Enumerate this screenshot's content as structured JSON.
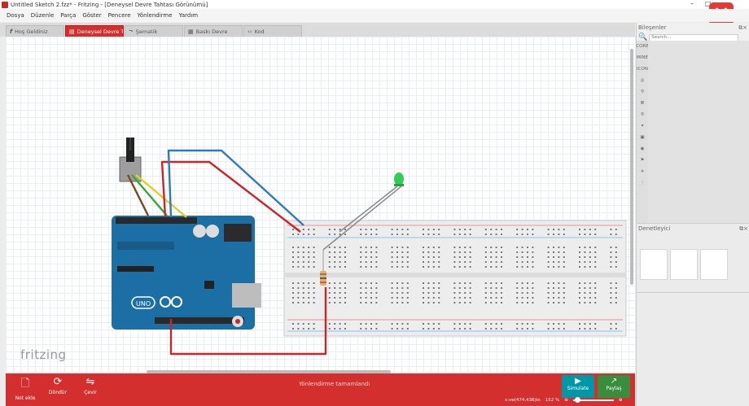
{
  "window": {
    "title": "Untitled Sketch 2.fzz* - Fritzing - [Deneysel Devre Tahtası Görünümü]",
    "minimize": "–",
    "restore": "□",
    "close_overlay": "✕"
  },
  "menu": [
    "Dosya",
    "Düzenle",
    "Parça",
    "Göster",
    "Pencere",
    "Yönlendirme",
    "Yardım"
  ],
  "tabs": [
    {
      "label": "Hoş Geldiniz",
      "icon": "f-logo-icon"
    },
    {
      "label": "Deneysel Devre Tahtası",
      "icon": "breadboard-icon",
      "active": true
    },
    {
      "label": "Şematik",
      "icon": "schematic-icon"
    },
    {
      "label": "Baskı Devre",
      "icon": "pcb-icon"
    },
    {
      "label": "Kod",
      "icon": "code-icon"
    }
  ],
  "canvas": {
    "watermark": "fritzing",
    "arduino_label": "UNO"
  },
  "toolbar": {
    "note": "Not ekle",
    "rotate": "Döndür",
    "flip": "Çevir",
    "status": "Yönlendirme tamamlandı",
    "simulate": "Simulate",
    "share": "Paylaş"
  },
  "footer": {
    "coords": "x:ve(474,436)in",
    "zoom": "152 %"
  },
  "panels": {
    "parts_title": "Bileşenler",
    "search_placeholder": "Search...",
    "inspector_title": "Denetleyici",
    "bins": [
      "CORE",
      "MINE",
      "ICON"
    ]
  },
  "colors": {
    "accent": "#d32f2f",
    "simulate": "#0097a7",
    "share": "#388e3c",
    "wire_red": "#c62828",
    "wire_blue": "#2b7bc4",
    "wire_yellow": "#e0d020",
    "wire_green": "#3aa63a",
    "wire_brown": "#7a4a22",
    "arduino": "#1c6fa4",
    "led": "#33cc55"
  }
}
